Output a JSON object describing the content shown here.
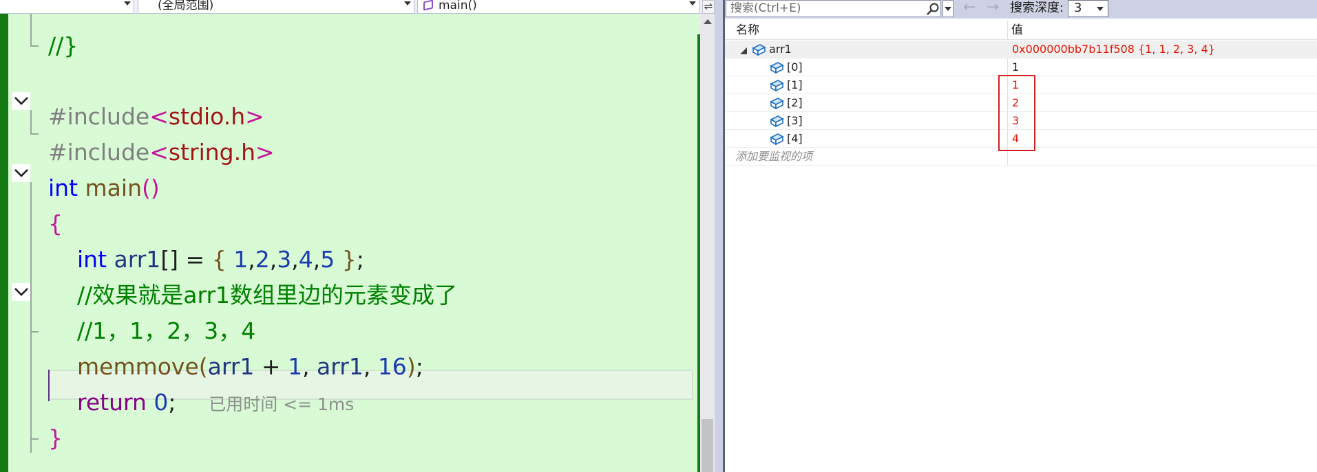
{
  "nav_bar": {
    "scope": "(全局范围)",
    "function": "main()"
  },
  "code_lines": [
    "//}",
    "#include<stdio.h>",
    "#include<string.h>",
    "int main()",
    "{",
    "int arr1[] = { 1,2,3,4,5 };",
    "//效果就是arr1数组里边的元素变成了",
    "//1，1，2，3，4",
    "memmove(arr1 + 1, arr1, 16);",
    "return 0;",
    "}"
  ],
  "code": {
    "line0": "//}",
    "include1": {
      "directive": "#include",
      "open": "<",
      "file": "stdio.h",
      "close": ">"
    },
    "include2": {
      "directive": "#include",
      "open": "<",
      "file": "string.h",
      "close": ">"
    },
    "main_sig": {
      "kw": "int",
      "name": "main",
      "parens": "()"
    },
    "brace_open": "{",
    "decl": {
      "kw": "int",
      "var": "arr1",
      "rest_a": "[] = ",
      "brace_a": "{",
      "v1": "1",
      "v2": "2",
      "v3": "3",
      "v4": "4",
      "v5": "5",
      "brace_b": "}",
      "semi": ";"
    },
    "comment1": "//效果就是arr1数组里边的元素变成了",
    "comment2": "//1，1，2，3，4",
    "memmove": {
      "fn": "memmove",
      "open": "(",
      "arg1": "arr1",
      "plus": " + ",
      "one": "1",
      "comma1": ", ",
      "arg2": "arr1",
      "comma2": ", ",
      "n": "16",
      "close": ")",
      "semi": ";"
    },
    "ret": {
      "kw": "return",
      "val": "0",
      "semi": ";"
    },
    "elapsed_hint": "已用时间 <= 1ms",
    "brace_close": "}"
  },
  "watch": {
    "search_placeholder": "搜索(Ctrl+E)",
    "back_arrow": "←",
    "forward_arrow": "→",
    "depth_label": "搜索深度:",
    "depth_value": "3",
    "col_name": "名称",
    "col_value": "值",
    "rows": [
      {
        "name": "arr1",
        "value": "0x000000bb7b11f508 {1, 1, 2, 3, 4}",
        "value_color": "#e51400"
      },
      {
        "name": "[0]",
        "value": "1",
        "value_color": "#1e1e1e"
      },
      {
        "name": "[1]",
        "value": "1",
        "value_color": "#e51400"
      },
      {
        "name": "[2]",
        "value": "2",
        "value_color": "#e51400"
      },
      {
        "name": "[3]",
        "value": "3",
        "value_color": "#e51400"
      },
      {
        "name": "[4]",
        "value": "4",
        "value_color": "#e51400"
      }
    ],
    "add_watch": "添加要监视的项"
  },
  "colors": {
    "editor_bg": "#d8fbd6",
    "keyword": "#0000ff",
    "comment": "#008000",
    "changed_value": "#e51400",
    "highlight": "#d21f1f"
  },
  "icons": [
    "chevron-down-icon",
    "cube-icon",
    "search-icon",
    "expander-icon",
    "variable-icon"
  ]
}
